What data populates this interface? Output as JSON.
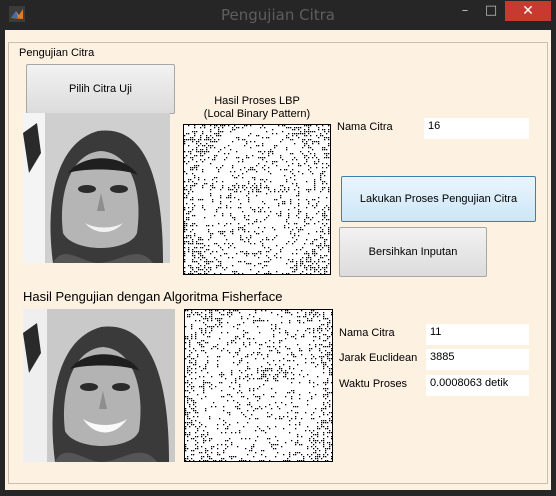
{
  "window": {
    "title": "Pengujian Citra",
    "close_glyph": "✕",
    "min_glyph": "–",
    "max_glyph": "□"
  },
  "panel": {
    "title": "Pengujian Citra"
  },
  "buttons": {
    "pilih": "Pilih Citra Uji",
    "proses": "Lakukan Proses Pengujian Citra",
    "bersih": "Bersihkan Inputan"
  },
  "lbp": {
    "title_line1": "Hasil Proses LBP",
    "title_line2": "(Local Binary Pattern)"
  },
  "test": {
    "nama_label": "Nama Citra",
    "nama_value": "16"
  },
  "section_title": "Hasil Pengujian dengan Algoritma Fisherface",
  "result": {
    "nama_label": "Nama Citra",
    "nama_value": "11",
    "jarak_label": "Jarak Euclidean",
    "jarak_value": "3885",
    "waktu_label": "Waktu Proses",
    "waktu_value": "0.0008063 detik"
  }
}
